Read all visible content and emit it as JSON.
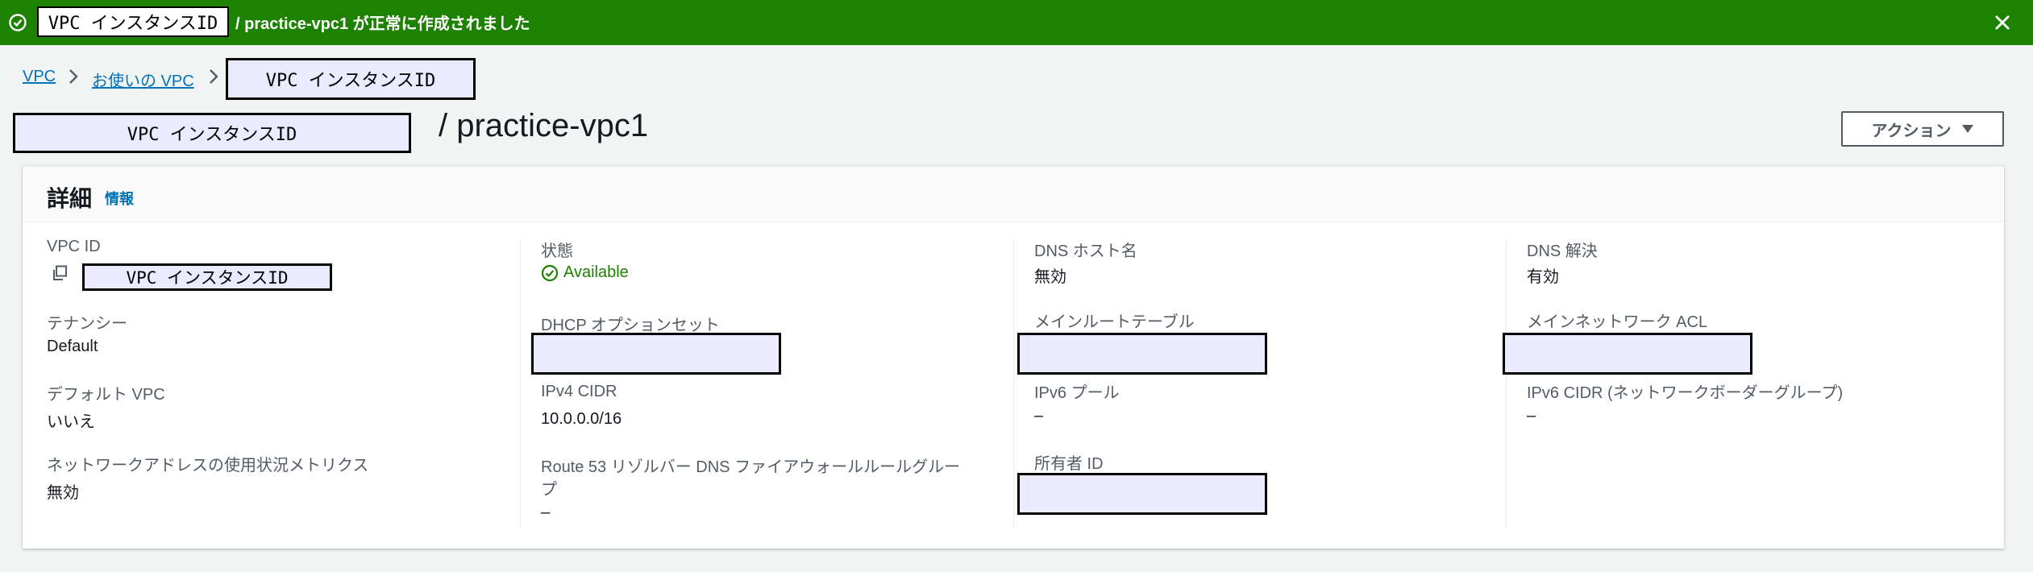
{
  "banner": {
    "redacted_id": "VPC インスタンスID",
    "message": "/ practice-vpc1 が正常に作成されました",
    "close_icon": "close-icon",
    "success_icon": "check-circle-icon",
    "color": "#1d8102"
  },
  "breadcrumb": {
    "items": [
      "VPC",
      "お使いの VPC"
    ],
    "current": "VPC インスタンスID"
  },
  "header": {
    "redacted_id": "VPC インスタンスID",
    "title": "/ practice-vpc1",
    "action_label": "アクション"
  },
  "details": {
    "title": "詳細",
    "info_label": "情報",
    "col1": {
      "vpc_id_label": "VPC ID",
      "vpc_id_value": "VPC インスタンスID",
      "tenancy_label": "テナンシー",
      "tenancy_value": "Default",
      "default_vpc_label": "デフォルト VPC",
      "default_vpc_value": "いいえ",
      "metrics_label": "ネットワークアドレスの使用状況メトリクス",
      "metrics_value": "無効"
    },
    "col2": {
      "state_label": "状態",
      "state_value": "Available",
      "dhcp_label": "DHCP オプションセット",
      "ipv4_label": "IPv4 CIDR",
      "ipv4_value": "10.0.0.0/16",
      "route53_label_line1": "Route 53 リゾルバー DNS ファイアウォールルールグルー",
      "route53_label_line2": "プ",
      "route53_value": "–"
    },
    "col3": {
      "dns_hostname_label": "DNS ホスト名",
      "dns_hostname_value": "無効",
      "main_route_label": "メインルートテーブル",
      "ipv6_pool_label": "IPv6 プール",
      "ipv6_pool_value": "–",
      "owner_label": "所有者 ID"
    },
    "col4": {
      "dns_resolution_label": "DNS 解決",
      "dns_resolution_value": "有効",
      "main_acl_label": "メインネットワーク ACL",
      "ipv6_cidr_label": "IPv6 CIDR (ネットワークボーダーグループ)",
      "ipv6_cidr_value": "–"
    }
  }
}
